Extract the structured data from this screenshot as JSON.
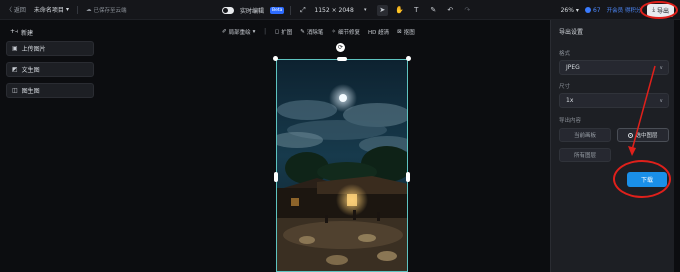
{
  "topbar": {
    "back": "〈 返回",
    "project_name": "未命名项目",
    "saved": "已保存至云端",
    "realtime_label": "实时编辑",
    "realtime_badge": "Beta",
    "size": "1152 × 2048",
    "zoom": "26%",
    "credits": "67",
    "member": "开会员 得积分",
    "export": "导出"
  },
  "sidebar": {
    "new_label": "新建",
    "items": [
      {
        "label": "上传图片",
        "icon": "image-upload-icon"
      },
      {
        "label": "文生图",
        "icon": "text-to-image-icon"
      },
      {
        "label": "图生图",
        "icon": "image-to-image-icon"
      }
    ]
  },
  "subbar": {
    "items": [
      "局部重绘",
      "扩图",
      "消除笔",
      "细节修复",
      "HD 超清",
      "抠图"
    ]
  },
  "panel": {
    "title": "导出设置",
    "format_label": "格式",
    "format_value": "JPEG",
    "size_label": "尺寸",
    "size_value": "1x",
    "content_label": "导出内容",
    "option_canvas": "当前画板",
    "option_layer": "选中图层",
    "option_all": "所有图层",
    "download": "下载"
  },
  "colors": {
    "accent": "#1a8fe8",
    "annotation": "#e0201b",
    "selection": "#5ec3c0"
  }
}
